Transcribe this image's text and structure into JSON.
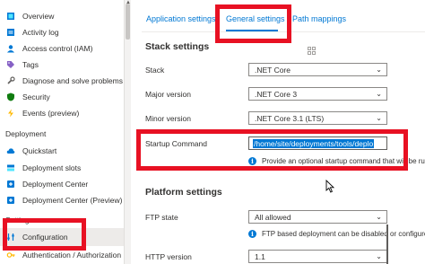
{
  "sidebar": {
    "items": [
      {
        "label": "Overview",
        "icon": "overview-icon"
      },
      {
        "label": "Activity log",
        "icon": "activity-log-icon"
      },
      {
        "label": "Access control (IAM)",
        "icon": "iam-icon"
      },
      {
        "label": "Tags",
        "icon": "tag-icon"
      },
      {
        "label": "Diagnose and solve problems",
        "icon": "wrench-icon"
      },
      {
        "label": "Security",
        "icon": "shield-icon"
      },
      {
        "label": "Events (preview)",
        "icon": "lightning-icon"
      }
    ],
    "deployment_section": "Deployment",
    "deployment_items": [
      {
        "label": "Quickstart",
        "icon": "cloud-icon"
      },
      {
        "label": "Deployment slots",
        "icon": "slots-icon"
      },
      {
        "label": "Deployment Center",
        "icon": "deployment-center-icon"
      },
      {
        "label": "Deployment Center (Preview)",
        "icon": "deployment-center-preview-icon"
      }
    ],
    "settings_section": "Settings",
    "settings_items": [
      {
        "label": "Configuration",
        "icon": "configuration-icon"
      },
      {
        "label": "Authentication / Authorization",
        "icon": "auth-icon"
      }
    ]
  },
  "tabs": [
    {
      "label": "Application settings"
    },
    {
      "label": "General settings"
    },
    {
      "label": "Path mappings"
    }
  ],
  "stack_settings": {
    "heading": "Stack settings",
    "stack_label": "Stack",
    "stack_value": ".NET Core",
    "major_label": "Major version",
    "major_value": ".NET Core 3",
    "minor_label": "Minor version",
    "minor_value": ".NET Core 3.1 (LTS)",
    "startup_label": "Startup Command",
    "startup_value": "/home/site/deployments/tools/deplo",
    "startup_info": "Provide an optional startup command that will be ru"
  },
  "platform_settings": {
    "heading": "Platform settings",
    "ftp_label": "FTP state",
    "ftp_value": "All allowed",
    "ftp_info": "FTP based deployment can be disabled or configured",
    "http_label": "HTTP version",
    "http_value": "1.1"
  },
  "colors": {
    "accent": "#0078d4",
    "highlight_box": "#e81123"
  }
}
